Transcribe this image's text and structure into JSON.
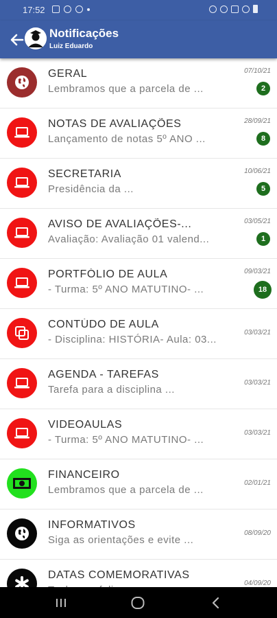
{
  "status_bar": {
    "time": "17:52"
  },
  "app_bar": {
    "title": "Notificações",
    "subtitle": "Luiz Eduardo"
  },
  "notifications": [
    {
      "title": "GERAL",
      "preview": "Lembramos que a parcela de ...",
      "date": "07/10/21",
      "badge": "2",
      "icon": "globe-icon",
      "color": "#9b2d2d"
    },
    {
      "title": "NOTAS DE AVALIAÇÕES",
      "preview": "Lançamento de notas 5º ANO ...",
      "date": "28/09/21",
      "badge": "8",
      "icon": "laptop-icon",
      "color": "#f01414"
    },
    {
      "title": "SECRETARIA",
      "preview": "Presidência da ...",
      "date": "10/06/21",
      "badge": "5",
      "icon": "laptop-icon",
      "color": "#f01414"
    },
    {
      "title": "AVISO DE AVALIAÇÕES-...",
      "preview": "Avaliação: Avaliação 01 valend...",
      "date": "03/05/21",
      "badge": "1",
      "icon": "laptop-icon",
      "color": "#f01414"
    },
    {
      "title": "PORTFÓLIO DE AULA",
      "preview": "- Turma: 5º ANO MATUTINO- ...",
      "date": "09/03/21",
      "badge": "18",
      "icon": "laptop-icon",
      "color": "#f01414"
    },
    {
      "title": "CONTÚDO DE AULA",
      "preview": "- Disciplina: HISTÓRIA- Aula: 03...",
      "date": "03/03/21",
      "badge": "",
      "icon": "copy-icon",
      "color": "#f01414"
    },
    {
      "title": "AGENDA - TAREFAS",
      "preview": "Tarefa para a disciplina ...",
      "date": "03/03/21",
      "badge": "",
      "icon": "laptop-icon",
      "color": "#f01414"
    },
    {
      "title": "VIDEOAULAS",
      "preview": "- Turma: 5º ANO MATUTINO- ...",
      "date": "03/03/21",
      "badge": "",
      "icon": "laptop-icon",
      "color": "#f01414"
    },
    {
      "title": "FINANCEIRO",
      "preview": "Lembramos que a parcela de ...",
      "date": "02/01/21",
      "badge": "",
      "icon": "money-icon",
      "color": "#22e01e"
    },
    {
      "title": "INFORMATIVOS",
      "preview": "Siga as orientações e evite ...",
      "date": "08/09/20",
      "badge": "",
      "icon": "globe-icon",
      "color": "#080808"
    },
    {
      "title": "DATAS COMEMORATIVAS",
      "preview": "Tenha um feliz ...",
      "date": "04/09/20",
      "badge": "",
      "icon": "asterisk-icon",
      "color": "#080808"
    }
  ]
}
